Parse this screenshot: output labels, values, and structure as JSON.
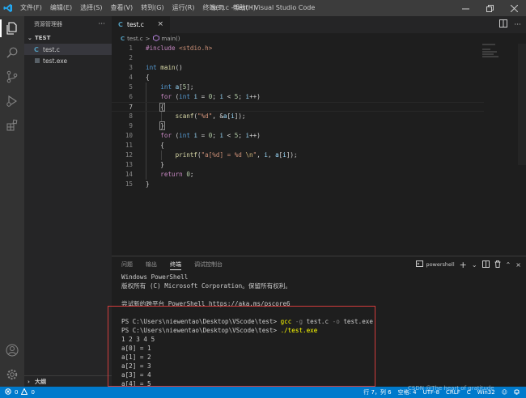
{
  "titlebar": {
    "menu": [
      "文件(F)",
      "编辑(E)",
      "选择(S)",
      "查看(V)",
      "转到(G)",
      "运行(R)",
      "终端(T)",
      "帮助(H)"
    ],
    "title": "test.c - test - Visual Studio Code"
  },
  "sidebar": {
    "header": "资源管理器",
    "section": "TEST",
    "files": [
      {
        "name": "test.c",
        "icon": "c-file-icon"
      },
      {
        "name": "test.exe",
        "icon": "exe-file-icon"
      }
    ],
    "outline": "大纲"
  },
  "editor": {
    "tab": {
      "icon": "C",
      "label": "test.c"
    },
    "breadcrumb": {
      "file_icon": "C",
      "file": "test.c",
      "sep": ">",
      "symbol": "main()"
    },
    "current_line": 7
  },
  "panel": {
    "tabs": [
      "问题",
      "输出",
      "终端",
      "调试控制台"
    ],
    "active_tab": "终端",
    "terminal_name": "powershell"
  },
  "terminal": {
    "header": [
      "Windows PowerShell",
      "版权所有 (C) Microsoft Corporation。保留所有权利。",
      "",
      "尝试新的跨平台 PowerShell https://aka.ms/pscore6",
      ""
    ],
    "prompt": "PS C:\\Users\\niewentao\\Desktop\\VScode\\test> ",
    "cmd1": {
      "cmd": "gcc",
      "flag1": " -g",
      "arg1": " test.c",
      "flag2": " -o",
      "arg2": " test.exe"
    },
    "cmd2": "./test.exe",
    "output": [
      "1 2 3 4 5",
      "a[0] = 1",
      "a[1] = 2",
      "a[2] = 3",
      "a[3] = 4",
      "a[4] = 5"
    ]
  },
  "statusbar": {
    "errors": "0",
    "warnings": "0",
    "position": "行 7，列 6",
    "spaces": "空格: 4",
    "encoding": "UTF-8",
    "eol": "CRLF",
    "language": "C",
    "platform": "Win32"
  },
  "watermark": "CSDN @The heart of gratitude",
  "colors": {
    "accent": "#007acc",
    "highlight_box": "#d23c3c",
    "keyword": "#569cd6",
    "control": "#c586c0",
    "function": "#dcdcaa",
    "string": "#ce9178"
  }
}
